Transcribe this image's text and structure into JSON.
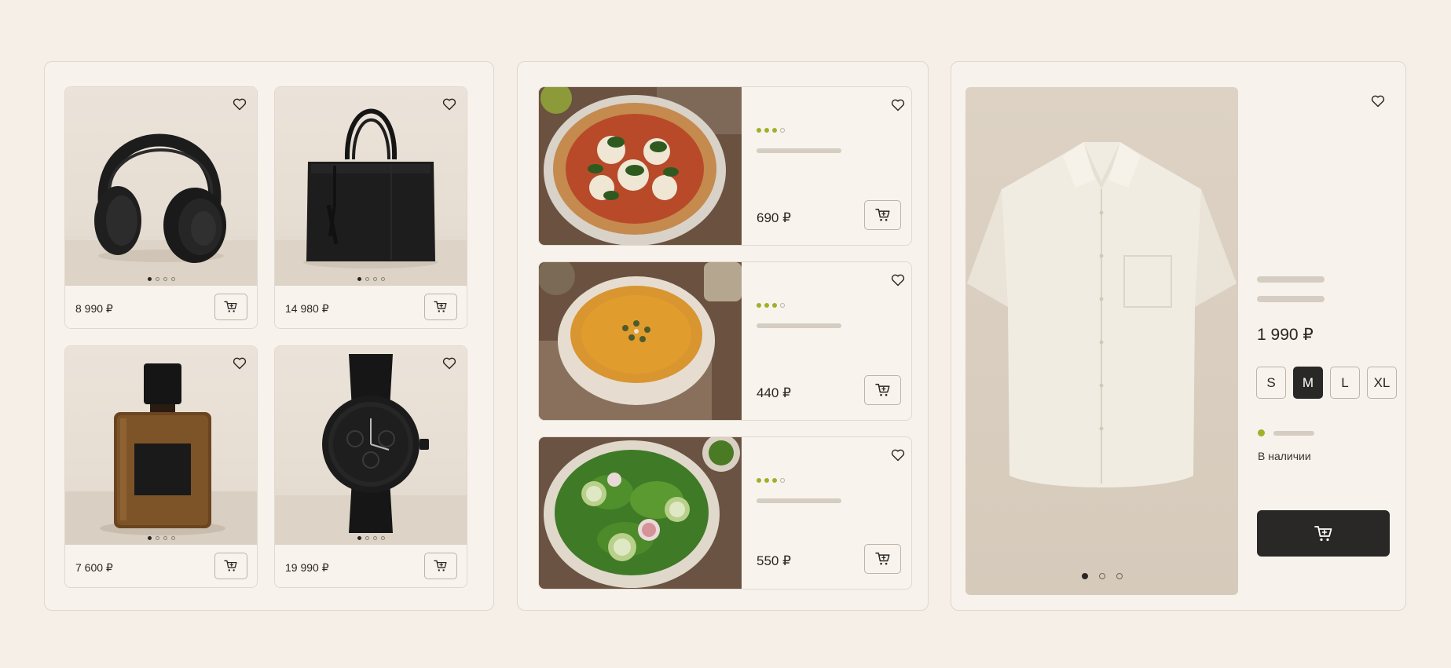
{
  "catalog_grid": {
    "products": [
      {
        "name_icon": "headphones-icon",
        "price": "8 990 ₽"
      },
      {
        "name_icon": "tote-bag-icon",
        "price": "14 980 ₽"
      },
      {
        "name_icon": "perfume-icon",
        "price": "7 600 ₽"
      },
      {
        "name_icon": "watch-icon",
        "price": "19 990 ₽"
      }
    ]
  },
  "food_list": {
    "items": [
      {
        "image_icon": "pizza-icon",
        "rating": 3,
        "rating_max": 4,
        "price": "690 ₽"
      },
      {
        "image_icon": "soup-icon",
        "rating": 3,
        "rating_max": 4,
        "price": "440 ₽"
      },
      {
        "image_icon": "salad-icon",
        "rating": 3,
        "rating_max": 4,
        "price": "550 ₽"
      }
    ]
  },
  "product_detail": {
    "image_icon": "shirt-icon",
    "price": "1 990 ₽",
    "sizes": [
      "S",
      "M",
      "L",
      "XL"
    ],
    "selected_size": "M",
    "stock_label": "В наличии",
    "buy_icon": "cart-icon"
  },
  "colors": {
    "background": "#f5efe8",
    "accent_green": "#a0b028",
    "primary_dark": "#2a2826"
  }
}
